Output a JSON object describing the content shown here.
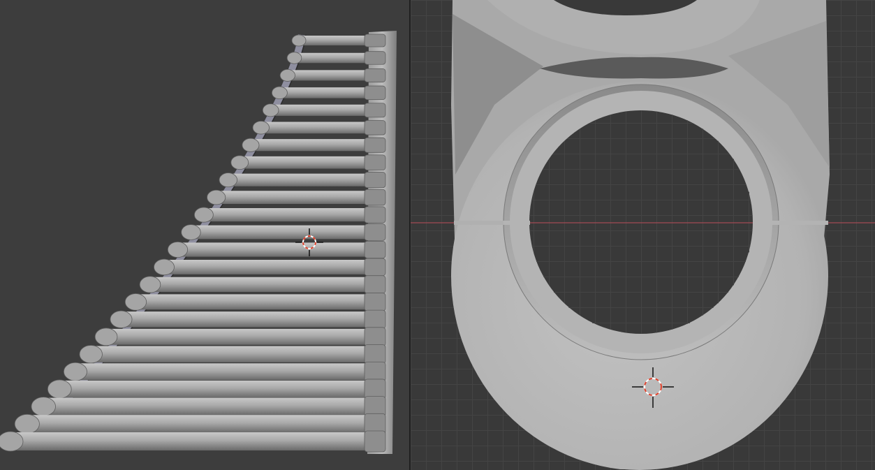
{
  "colors": {
    "viewport_bg": "#3d3d3d",
    "ortho_viewport_bg": "#393939",
    "grid_minor": "#444444",
    "grid_major": "#4a4a4a",
    "x_axis": "#a34a55",
    "mesh_light": "#b9b9b9",
    "mesh_mid": "#9b9b9b",
    "mesh_dark": "#6f6f6f",
    "cursor_red": "#e0402a",
    "cursor_white": "#ffffff"
  },
  "left_viewport": {
    "view": "perspective",
    "object": "ladder-mesh",
    "rung_count": 24
  },
  "right_viewport": {
    "view": "orthographic",
    "object": "chain-link-mesh",
    "grid": true,
    "x_axis_visible": true
  },
  "icons": [
    "3d-cursor-icon"
  ]
}
